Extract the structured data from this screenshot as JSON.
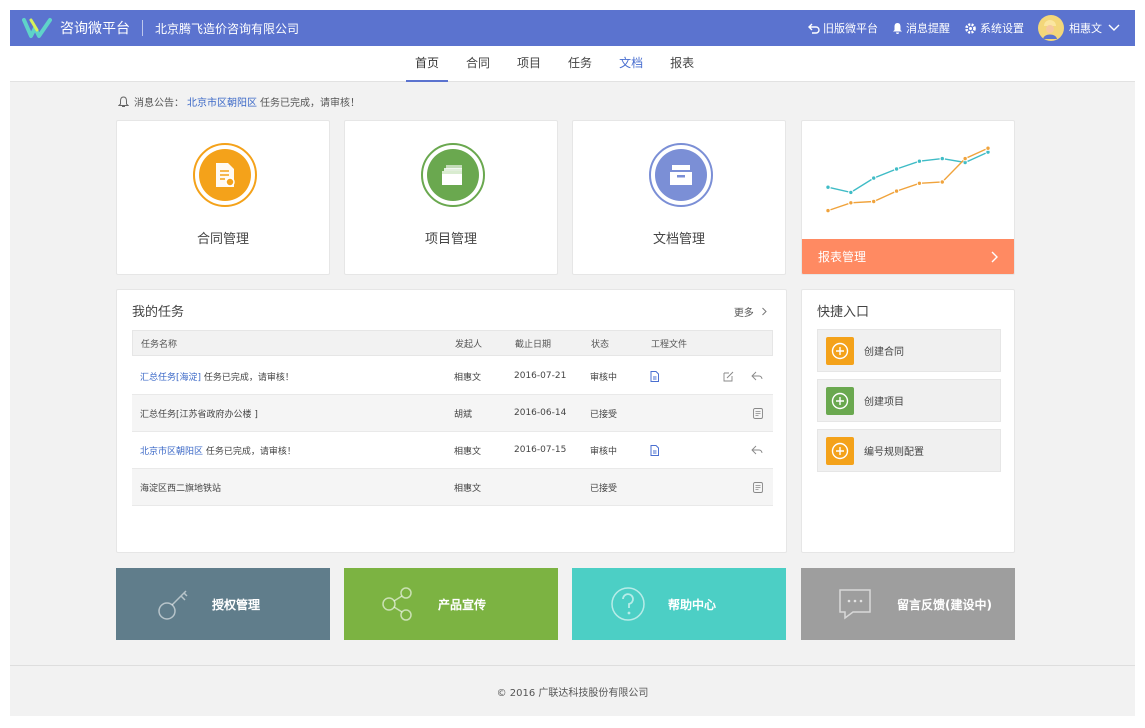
{
  "header": {
    "app_name": "咨询微平台",
    "company": "北京腾飞造价咨询有限公司",
    "old_platform": "旧版微平台",
    "notifications": "消息提醒",
    "settings": "系统设置",
    "user_name": "相惠文"
  },
  "nav": {
    "tabs": [
      {
        "label": "首页"
      },
      {
        "label": "合同"
      },
      {
        "label": "项目"
      },
      {
        "label": "任务"
      },
      {
        "label": "文档"
      },
      {
        "label": "报表"
      }
    ],
    "active_index": 0
  },
  "notice": {
    "prefix": "消息公告：",
    "link": "北京市区朝阳区",
    "text": "任务已完成，请审核！"
  },
  "modules": [
    {
      "label": "合同管理",
      "color": "#f4a21a"
    },
    {
      "label": "项目管理",
      "color": "#6aa84f"
    },
    {
      "label": "文档管理",
      "color": "#7b8fd6"
    }
  ],
  "report": {
    "label": "报表管理",
    "color": "#ff8a62",
    "chart_data": {
      "type": "line",
      "series": [
        {
          "color": "#3fbcc6",
          "points": [
            [
              0,
              3.6
            ],
            [
              1,
              3.2
            ],
            [
              2,
              4.3
            ],
            [
              3,
              5.0
            ],
            [
              4,
              5.6
            ],
            [
              5,
              5.8
            ],
            [
              6,
              5.5
            ],
            [
              7,
              6.3
            ]
          ]
        },
        {
          "color": "#f0a33c",
          "points": [
            [
              0,
              1.8
            ],
            [
              1,
              2.4
            ],
            [
              2,
              2.5
            ],
            [
              3,
              3.3
            ],
            [
              4,
              3.9
            ],
            [
              5,
              4.0
            ],
            [
              6,
              5.8
            ],
            [
              7,
              6.6
            ]
          ]
        }
      ]
    }
  },
  "tasks": {
    "title": "我的任务",
    "more": "更多",
    "columns": [
      "任务名称",
      "发起人",
      "截止日期",
      "状态",
      "工程文件"
    ],
    "rows": [
      {
        "link": "汇总任务[海淀]",
        "text": "任务已完成，请审核！",
        "initiator": "相惠文",
        "date": "2016-07-21",
        "status": "审核中",
        "file": true,
        "actions": [
          "edit",
          "reply"
        ]
      },
      {
        "link": "",
        "text": "汇总任务[江苏省政府办公楼 ]",
        "initiator": "胡斌",
        "date": "2016-06-14",
        "status": "已接受",
        "file": false,
        "actions": [
          "doc"
        ]
      },
      {
        "link": "北京市区朝阳区",
        "text": "任务已完成，请审核！",
        "initiator": "相惠文",
        "date": "2016-07-15",
        "status": "审核中",
        "file": true,
        "actions": [
          "reply"
        ]
      },
      {
        "link": "",
        "text": "海淀区西二旗地铁站",
        "initiator": "相惠文",
        "date": "",
        "status": "已接受",
        "file": false,
        "actions": [
          "doc"
        ]
      }
    ]
  },
  "quick": {
    "title": "快捷入口",
    "items": [
      {
        "label": "创建合同",
        "color": "#f4a21a"
      },
      {
        "label": "创建项目",
        "color": "#6aa84f"
      },
      {
        "label": "编号规则配置",
        "color": "#f4a21a"
      }
    ]
  },
  "tiles": [
    {
      "label": "授权管理",
      "color": "#607d8b"
    },
    {
      "label": "产品宣传",
      "color": "#7cb342"
    },
    {
      "label": "帮助中心",
      "color": "#4ccfc5"
    },
    {
      "label": "留言反馈(建设中)",
      "color": "#9e9e9e"
    }
  ],
  "footer": {
    "text": "© 2016 广联达科技股份有限公司"
  }
}
